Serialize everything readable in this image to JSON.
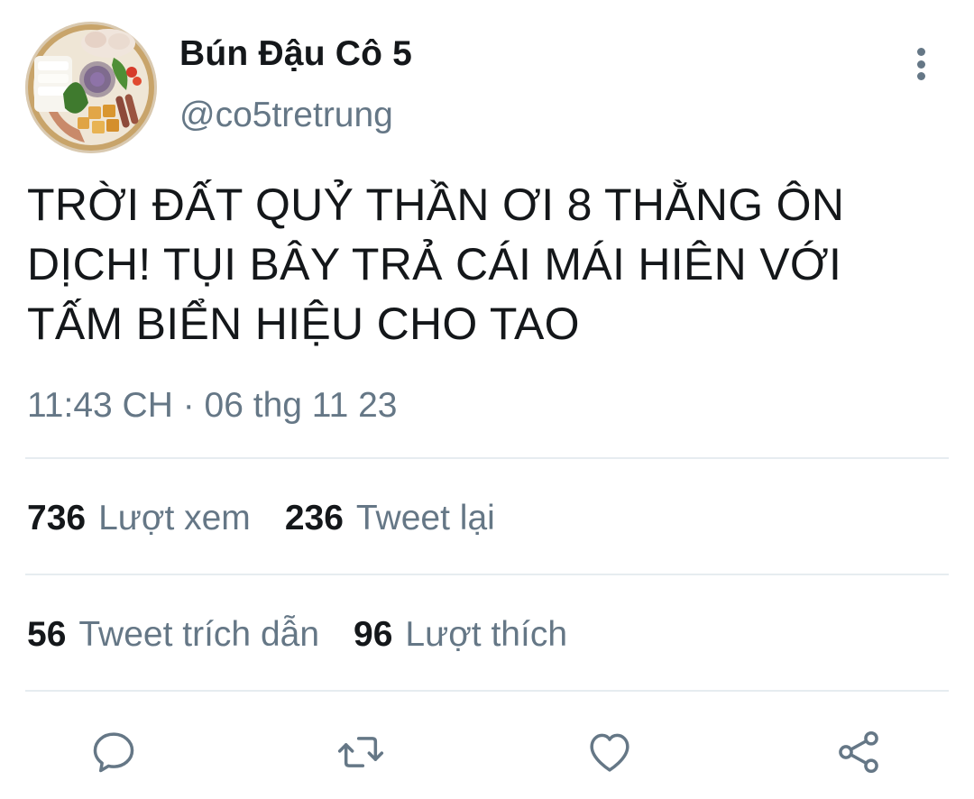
{
  "user": {
    "display_name": "Bún Đậu Cô 5",
    "handle": "@co5tretrung"
  },
  "tweet": {
    "text_lines": [
      "TRỜI ĐẤT QUỶ THẦN ƠI 8 THẰNG ÔN",
      "DỊCH! TỤI BÂY TRẢ CÁI MÁI HIÊN VỚI",
      "TẤM BIỂN HIỆU CHO TAO"
    ],
    "timestamp": "11:43 CH · 06 thg 11 23"
  },
  "stats": {
    "views": {
      "count": "736",
      "label": "Lượt xem"
    },
    "retweets": {
      "count": "236",
      "label": "Tweet lại"
    },
    "quotes": {
      "count": "56",
      "label": "Tweet trích dẫn"
    },
    "likes": {
      "count": "96",
      "label": "Lượt thích"
    }
  },
  "actions": {
    "reply": "reply-icon",
    "retweet": "retweet-icon",
    "like": "heart-icon",
    "share": "share-icon"
  },
  "colors": {
    "text_primary": "#14171a",
    "text_secondary": "#657786",
    "divider": "#e6ecf0"
  }
}
